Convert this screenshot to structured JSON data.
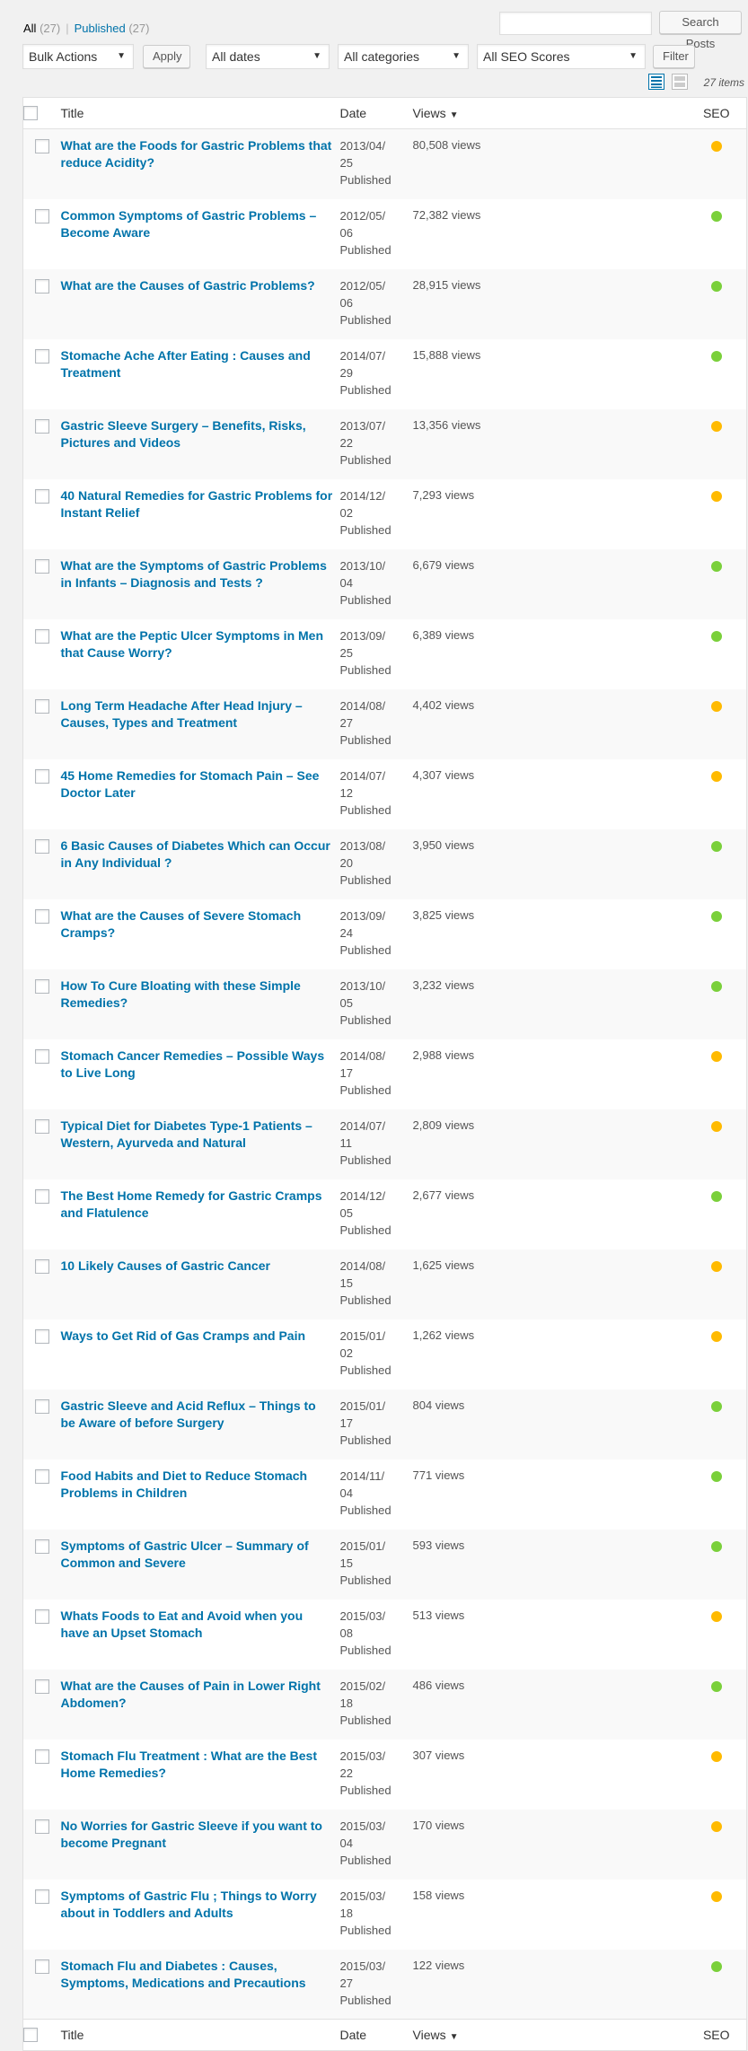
{
  "filters": {
    "all_label": "All",
    "all_count": "(27)",
    "published_label": "Published",
    "published_count": "(27)",
    "search_button": "Search Posts",
    "bulk_actions": "Bulk Actions",
    "apply_button": "Apply",
    "dates": "All dates",
    "categories": "All categories",
    "seo_scores": "All SEO Scores",
    "filter_button": "Filter",
    "items_count": "27 items"
  },
  "columns": {
    "title": "Title",
    "date": "Date",
    "views": "Views",
    "seo": "SEO"
  },
  "colors": {
    "seo_good": "#7ad03a",
    "seo_ok": "#ffba00",
    "link": "#0073aa"
  },
  "posts": [
    {
      "title": "What are the Foods for Gastric Problems that reduce Acidity?",
      "date1": "2013/04/",
      "date2": "25",
      "status": "Published",
      "views": "80,508 views",
      "seo": "ok"
    },
    {
      "title": "Common Symptoms of Gastric Problems – Become Aware",
      "date1": "2012/05/",
      "date2": "06",
      "status": "Published",
      "views": "72,382 views",
      "seo": "good"
    },
    {
      "title": "What are the Causes of Gastric Problems?",
      "date1": "2012/05/",
      "date2": "06",
      "status": "Published",
      "views": "28,915 views",
      "seo": "good"
    },
    {
      "title": "Stomache Ache After Eating : Causes and Treatment",
      "date1": "2014/07/",
      "date2": "29",
      "status": "Published",
      "views": "15,888 views",
      "seo": "good"
    },
    {
      "title": "Gastric Sleeve Surgery – Benefits, Risks, Pictures and Videos",
      "date1": "2013/07/",
      "date2": "22",
      "status": "Published",
      "views": "13,356 views",
      "seo": "ok"
    },
    {
      "title": "40 Natural Remedies for Gastric Problems for Instant Relief",
      "date1": "2014/12/",
      "date2": "02",
      "status": "Published",
      "views": "7,293 views",
      "seo": "ok"
    },
    {
      "title": "What are the Symptoms of Gastric Problems in Infants – Diagnosis and Tests ?",
      "date1": "2013/10/",
      "date2": "04",
      "status": "Published",
      "views": "6,679 views",
      "seo": "good"
    },
    {
      "title": "What are the Peptic Ulcer Symptoms in Men that Cause Worry?",
      "date1": "2013/09/",
      "date2": "25",
      "status": "Published",
      "views": "6,389 views",
      "seo": "good"
    },
    {
      "title": "Long Term Headache After Head Injury – Causes, Types and Treatment",
      "date1": "2014/08/",
      "date2": "27",
      "status": "Published",
      "views": "4,402 views",
      "seo": "ok"
    },
    {
      "title": "45 Home Remedies for Stomach Pain – See Doctor Later",
      "date1": "2014/07/",
      "date2": "12",
      "status": "Published",
      "views": "4,307 views",
      "seo": "ok"
    },
    {
      "title": "6 Basic Causes of Diabetes Which can Occur in Any Individual ?",
      "date1": "2013/08/",
      "date2": "20",
      "status": "Published",
      "views": "3,950 views",
      "seo": "good"
    },
    {
      "title": "What are the Causes of Severe Stomach Cramps?",
      "date1": "2013/09/",
      "date2": "24",
      "status": "Published",
      "views": "3,825 views",
      "seo": "good"
    },
    {
      "title": "How To Cure Bloating with these Simple Remedies?",
      "date1": "2013/10/",
      "date2": "05",
      "status": "Published",
      "views": "3,232 views",
      "seo": "good"
    },
    {
      "title": "Stomach Cancer Remedies – Possible Ways to Live Long",
      "date1": "2014/08/",
      "date2": "17",
      "status": "Published",
      "views": "2,988 views",
      "seo": "ok"
    },
    {
      "title": "Typical Diet for Diabetes Type-1 Patients – Western, Ayurveda and Natural",
      "date1": "2014/07/",
      "date2": "11",
      "status": "Published",
      "views": "2,809 views",
      "seo": "ok"
    },
    {
      "title": "The Best Home Remedy for Gastric Cramps and Flatulence",
      "date1": "2014/12/",
      "date2": "05",
      "status": "Published",
      "views": "2,677 views",
      "seo": "good"
    },
    {
      "title": "10 Likely Causes of Gastric Cancer",
      "date1": "2014/08/",
      "date2": "15",
      "status": "Published",
      "views": "1,625 views",
      "seo": "ok"
    },
    {
      "title": "Ways to Get Rid of Gas Cramps and Pain",
      "date1": "2015/01/",
      "date2": "02",
      "status": "Published",
      "views": "1,262 views",
      "seo": "ok"
    },
    {
      "title": "Gastric Sleeve and Acid Reflux – Things to be Aware of before Surgery",
      "date1": "2015/01/",
      "date2": "17",
      "status": "Published",
      "views": "804 views",
      "seo": "good"
    },
    {
      "title": "Food Habits and Diet to Reduce Stomach Problems in Children",
      "date1": "2014/11/",
      "date2": "04",
      "status": "Published",
      "views": "771 views",
      "seo": "good"
    },
    {
      "title": "Symptoms of Gastric Ulcer – Summary of Common and Severe",
      "date1": "2015/01/",
      "date2": "15",
      "status": "Published",
      "views": "593 views",
      "seo": "good"
    },
    {
      "title": "Whats Foods to Eat and Avoid when you have an Upset Stomach",
      "date1": "2015/03/",
      "date2": "08",
      "status": "Published",
      "views": "513 views",
      "seo": "ok"
    },
    {
      "title": "What are the Causes of Pain in Lower Right Abdomen?",
      "date1": "2015/02/",
      "date2": "18",
      "status": "Published",
      "views": "486 views",
      "seo": "good"
    },
    {
      "title": "Stomach Flu Treatment : What are the Best Home Remedies?",
      "date1": "2015/03/",
      "date2": "22",
      "status": "Published",
      "views": "307 views",
      "seo": "ok"
    },
    {
      "title": "No Worries for Gastric Sleeve if you want to become Pregnant",
      "date1": "2015/03/",
      "date2": "04",
      "status": "Published",
      "views": "170 views",
      "seo": "ok"
    },
    {
      "title": "Symptoms of Gastric Flu ; Things to Worry about in Toddlers and Adults",
      "date1": "2015/03/",
      "date2": "18",
      "status": "Published",
      "views": "158 views",
      "seo": "ok"
    },
    {
      "title": "Stomach Flu and Diabetes : Causes, Symptoms, Medications and Precautions",
      "date1": "2015/03/",
      "date2": "27",
      "status": "Published",
      "views": "122 views",
      "seo": "good"
    }
  ]
}
